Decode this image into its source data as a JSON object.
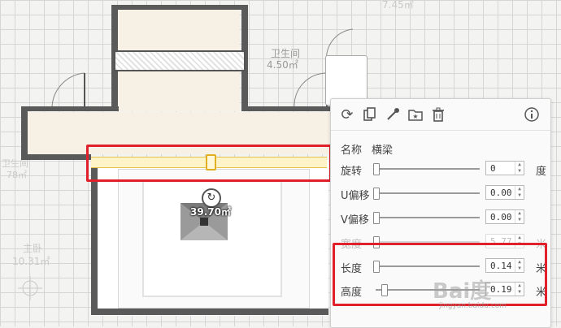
{
  "rooms": {
    "bathroom": {
      "name": "卫生间",
      "area": "4.50㎡"
    },
    "top_right_area": "7.45㎡",
    "left_room": {
      "name": "卫生间",
      "area": "78㎡"
    },
    "bedroom": {
      "name": "主卧",
      "area": "10.31㎡"
    },
    "main_room_area": "39.70㎡"
  },
  "toolbar": {
    "icons": [
      "refresh-icon",
      "copy-icon",
      "eyedropper-icon",
      "favorite-folder-icon",
      "delete-icon",
      "info-icon"
    ]
  },
  "properties": {
    "name_label": "名称",
    "name_value": "横梁",
    "rows": [
      {
        "label": "旋转",
        "value": "0",
        "unit": "度",
        "level": 0.0,
        "disabled": false
      },
      {
        "label": "U偏移",
        "value": "0.00",
        "unit": "",
        "level": 0.0,
        "disabled": false
      },
      {
        "label": "V偏移",
        "value": "0.00",
        "unit": "",
        "level": 0.0,
        "disabled": false
      },
      {
        "label": "宽度",
        "value": "5.77",
        "unit": "米",
        "level": 0.0,
        "disabled": true
      },
      {
        "label": "长度",
        "value": "0.14",
        "unit": "米",
        "level": 0.0,
        "disabled": false
      },
      {
        "label": "高度",
        "value": "0.19",
        "unit": "米",
        "level": 0.08,
        "disabled": false
      }
    ]
  },
  "watermark": {
    "main": "Bai度",
    "sub": "jingyan.baidu.com"
  },
  "colors": {
    "highlight": "#e0202a",
    "beam": "#fff4c8",
    "wall": "#5a5a5a"
  }
}
